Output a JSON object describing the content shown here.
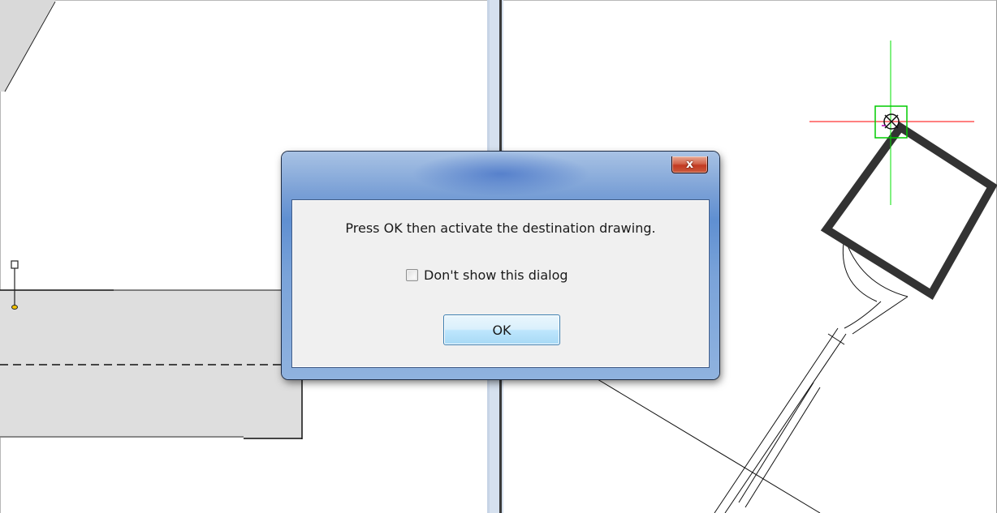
{
  "dialog": {
    "message": "Press OK then activate the destination drawing.",
    "checkbox_label": "Don't show this dialog",
    "checkbox_checked": false,
    "ok_label": "OK",
    "close_glyph": "x"
  },
  "colors": {
    "crosshair_horizontal": "#ff0000",
    "crosshair_vertical": "#00e000",
    "object_snap_marker": "#00cc00",
    "hatch_fill": "#d9d9d9",
    "viewport_splitter": "#d6e1ef"
  }
}
